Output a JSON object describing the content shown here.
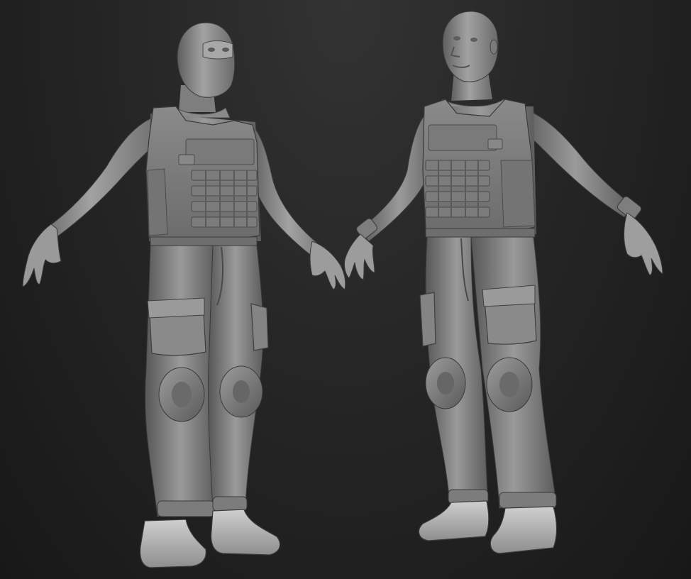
{
  "scene": {
    "description_visible_text": "",
    "background": {
      "top": "#333333",
      "mid": "#262626",
      "bottom": "#181818"
    },
    "material": {
      "base": "#8c8c8c",
      "light": "#b4b4b4",
      "shadow": "#565656",
      "dark": "#3e3e3e",
      "edge": "#2e2e2e"
    },
    "figures": [
      {
        "id": "masked-soldier",
        "pose": "A-pose",
        "headgear": "balaclava"
      },
      {
        "id": "unmasked-soldier",
        "pose": "A-pose",
        "headgear": "none"
      }
    ]
  }
}
